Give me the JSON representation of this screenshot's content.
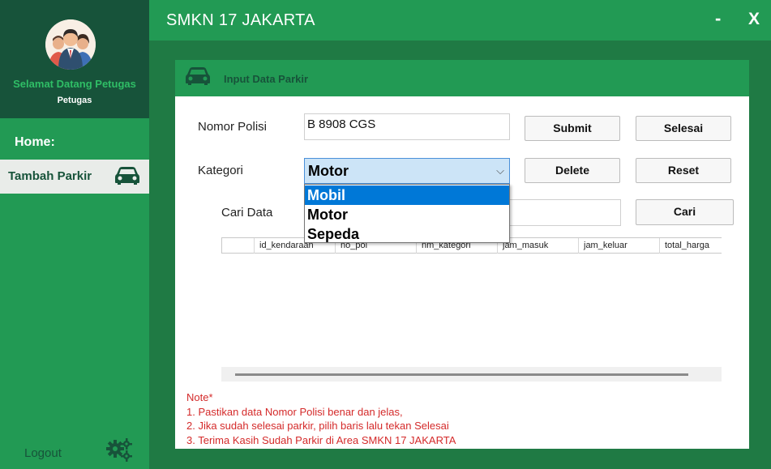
{
  "sidebar": {
    "welcome": "Selamat Datang Petugas",
    "role": "Petugas",
    "home_label": "Home:",
    "nav_item": "Tambah Parkir",
    "logout_label": "Logout"
  },
  "titlebar": {
    "title": "SMKN 17 JAKARTA",
    "minimize": "-",
    "close": "X"
  },
  "panel": {
    "title": "Input Data Parkir"
  },
  "form": {
    "nomor_polisi_label": "Nomor Polisi",
    "nomor_polisi_value": "B 8908 CGS",
    "kategori_label": "Kategori",
    "kategori_value": "Motor",
    "kategori_options": [
      "Mobil",
      "Motor",
      "Sepeda"
    ],
    "cari_label": "Cari Data",
    "cari_value": ""
  },
  "buttons": {
    "submit": "Submit",
    "selesai": "Selesai",
    "delete": "Delete",
    "reset": "Reset",
    "cari": "Cari"
  },
  "table": {
    "columns": [
      "id_kendaraan",
      "no_pol",
      "nm_kategori",
      "jam_masuk",
      "jam_keluar",
      "total_harga"
    ]
  },
  "notes": [
    "Note*",
    "1. Pastikan data Nomor Polisi benar dan jelas,",
    "2. Jika sudah selesai parkir, pilih baris lalu tekan Selesai",
    "3. Terima Kasih Sudah Parkir di Area SMKN 17 JAKARTA"
  ],
  "colors": {
    "primary_green": "#229a54",
    "dark_green": "#17533a",
    "note_red": "#d42a2a",
    "selection_blue": "#0078d7"
  },
  "icons": [
    "people-avatar-icon",
    "car-icon",
    "gears-icon",
    "chevron-down-icon"
  ]
}
